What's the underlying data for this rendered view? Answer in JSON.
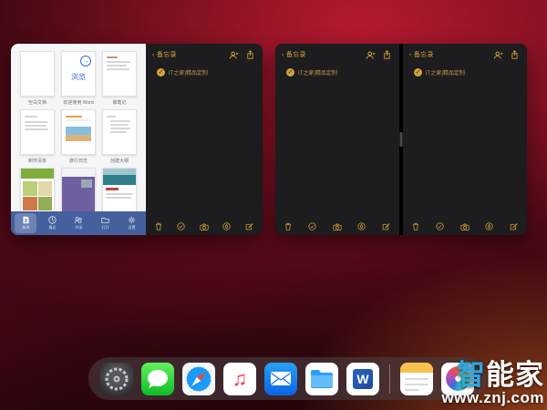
{
  "switcher": {
    "word": {
      "templates": [
        {
          "label": "空白文档",
          "overlay": ""
        },
        {
          "label": "欢迎使用 Word",
          "overlay": "浏览"
        },
        {
          "label": "做笔记",
          "overlay": ""
        },
        {
          "label": "制作清单",
          "overlay": ""
        },
        {
          "label": "旅行日志",
          "overlay": ""
        },
        {
          "label": "创建大纲",
          "overlay": ""
        },
        {
          "label": "",
          "overlay": ""
        },
        {
          "label": "",
          "overlay": ""
        },
        {
          "label": "",
          "overlay": ""
        }
      ],
      "tabs": [
        {
          "label": "新建"
        },
        {
          "label": "最近"
        },
        {
          "label": "共享"
        },
        {
          "label": "打开"
        },
        {
          "label": "设置"
        }
      ]
    },
    "notes_panels": [
      {
        "back": "备忘录",
        "check": "✓",
        "item": "IT之家|精品定制"
      },
      {
        "back": "备忘录",
        "check": "✓",
        "item": "IT之家|精品定制"
      },
      {
        "back": "备忘录",
        "check": "✓",
        "item": "IT之家|精品定制"
      }
    ]
  },
  "dock": {
    "apps": [
      "Settings",
      "Messages",
      "Safari",
      "Music",
      "Mail",
      "Files",
      "Word",
      "Notes",
      "Photos"
    ]
  },
  "watermark": {
    "brand_accent": "智",
    "brand_rest": "能家",
    "url": "www.znj.com"
  },
  "colors": {
    "notes_accent": "#d3a43c",
    "word_toolbar_blue": "#44609d",
    "wallpaper_red": "#8a1020"
  }
}
